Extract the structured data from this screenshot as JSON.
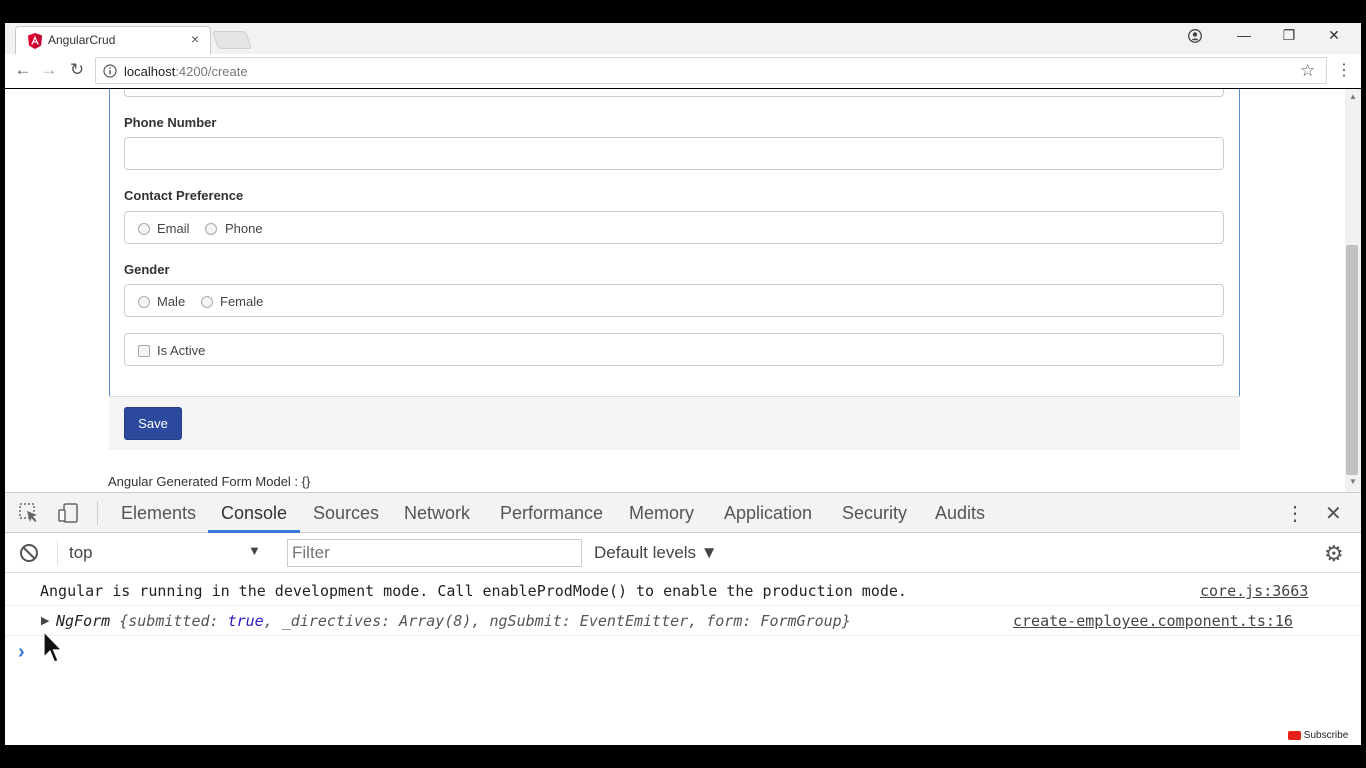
{
  "browser": {
    "tab_title": "AngularCrud",
    "tab_close": "×",
    "url_host": "localhost",
    "url_path": ":4200/create",
    "window_controls": {
      "minimize": "—",
      "maximize": "❐",
      "close": "✕"
    },
    "icons": [
      "angular-logo-icon",
      "back-icon",
      "forward-icon",
      "reload-icon",
      "info-icon",
      "star-icon",
      "menu-dots-icon",
      "profile-icon"
    ]
  },
  "form": {
    "phone_label": "Phone Number",
    "phone_value": "",
    "contact_label": "Contact Preference",
    "contact_options": [
      "Email",
      "Phone"
    ],
    "gender_label": "Gender",
    "gender_options": [
      "Male",
      "Female"
    ],
    "is_active_label": "Is Active",
    "save_label": "Save",
    "model_text": "Angular Generated Form Model : {}"
  },
  "devtools": {
    "tabs": [
      "Elements",
      "Console",
      "Sources",
      "Network",
      "Performance",
      "Memory",
      "Application",
      "Security",
      "Audits"
    ],
    "active_tab": "Console",
    "context": "top",
    "filter_placeholder": "Filter",
    "levels": "Default levels",
    "console": [
      {
        "message": "Angular is running in the development mode. Call enableProdMode() to enable the production mode.",
        "source": "core.js:3663"
      },
      {
        "prefix": "NgForm ",
        "part1": "{submitted: ",
        "true_kw": "true",
        "part2": ", _directives: Array(8), ngSubmit: EventEmitter, form: FormGroup}",
        "source": "create-employee.component.ts:16"
      }
    ],
    "prompt": "›"
  },
  "overlay": {
    "subscribe": "Subscribe"
  },
  "colors": {
    "accent": "#2b4a9e",
    "panel_border": "#5c89c8",
    "devtools_active": "#3879d9"
  }
}
